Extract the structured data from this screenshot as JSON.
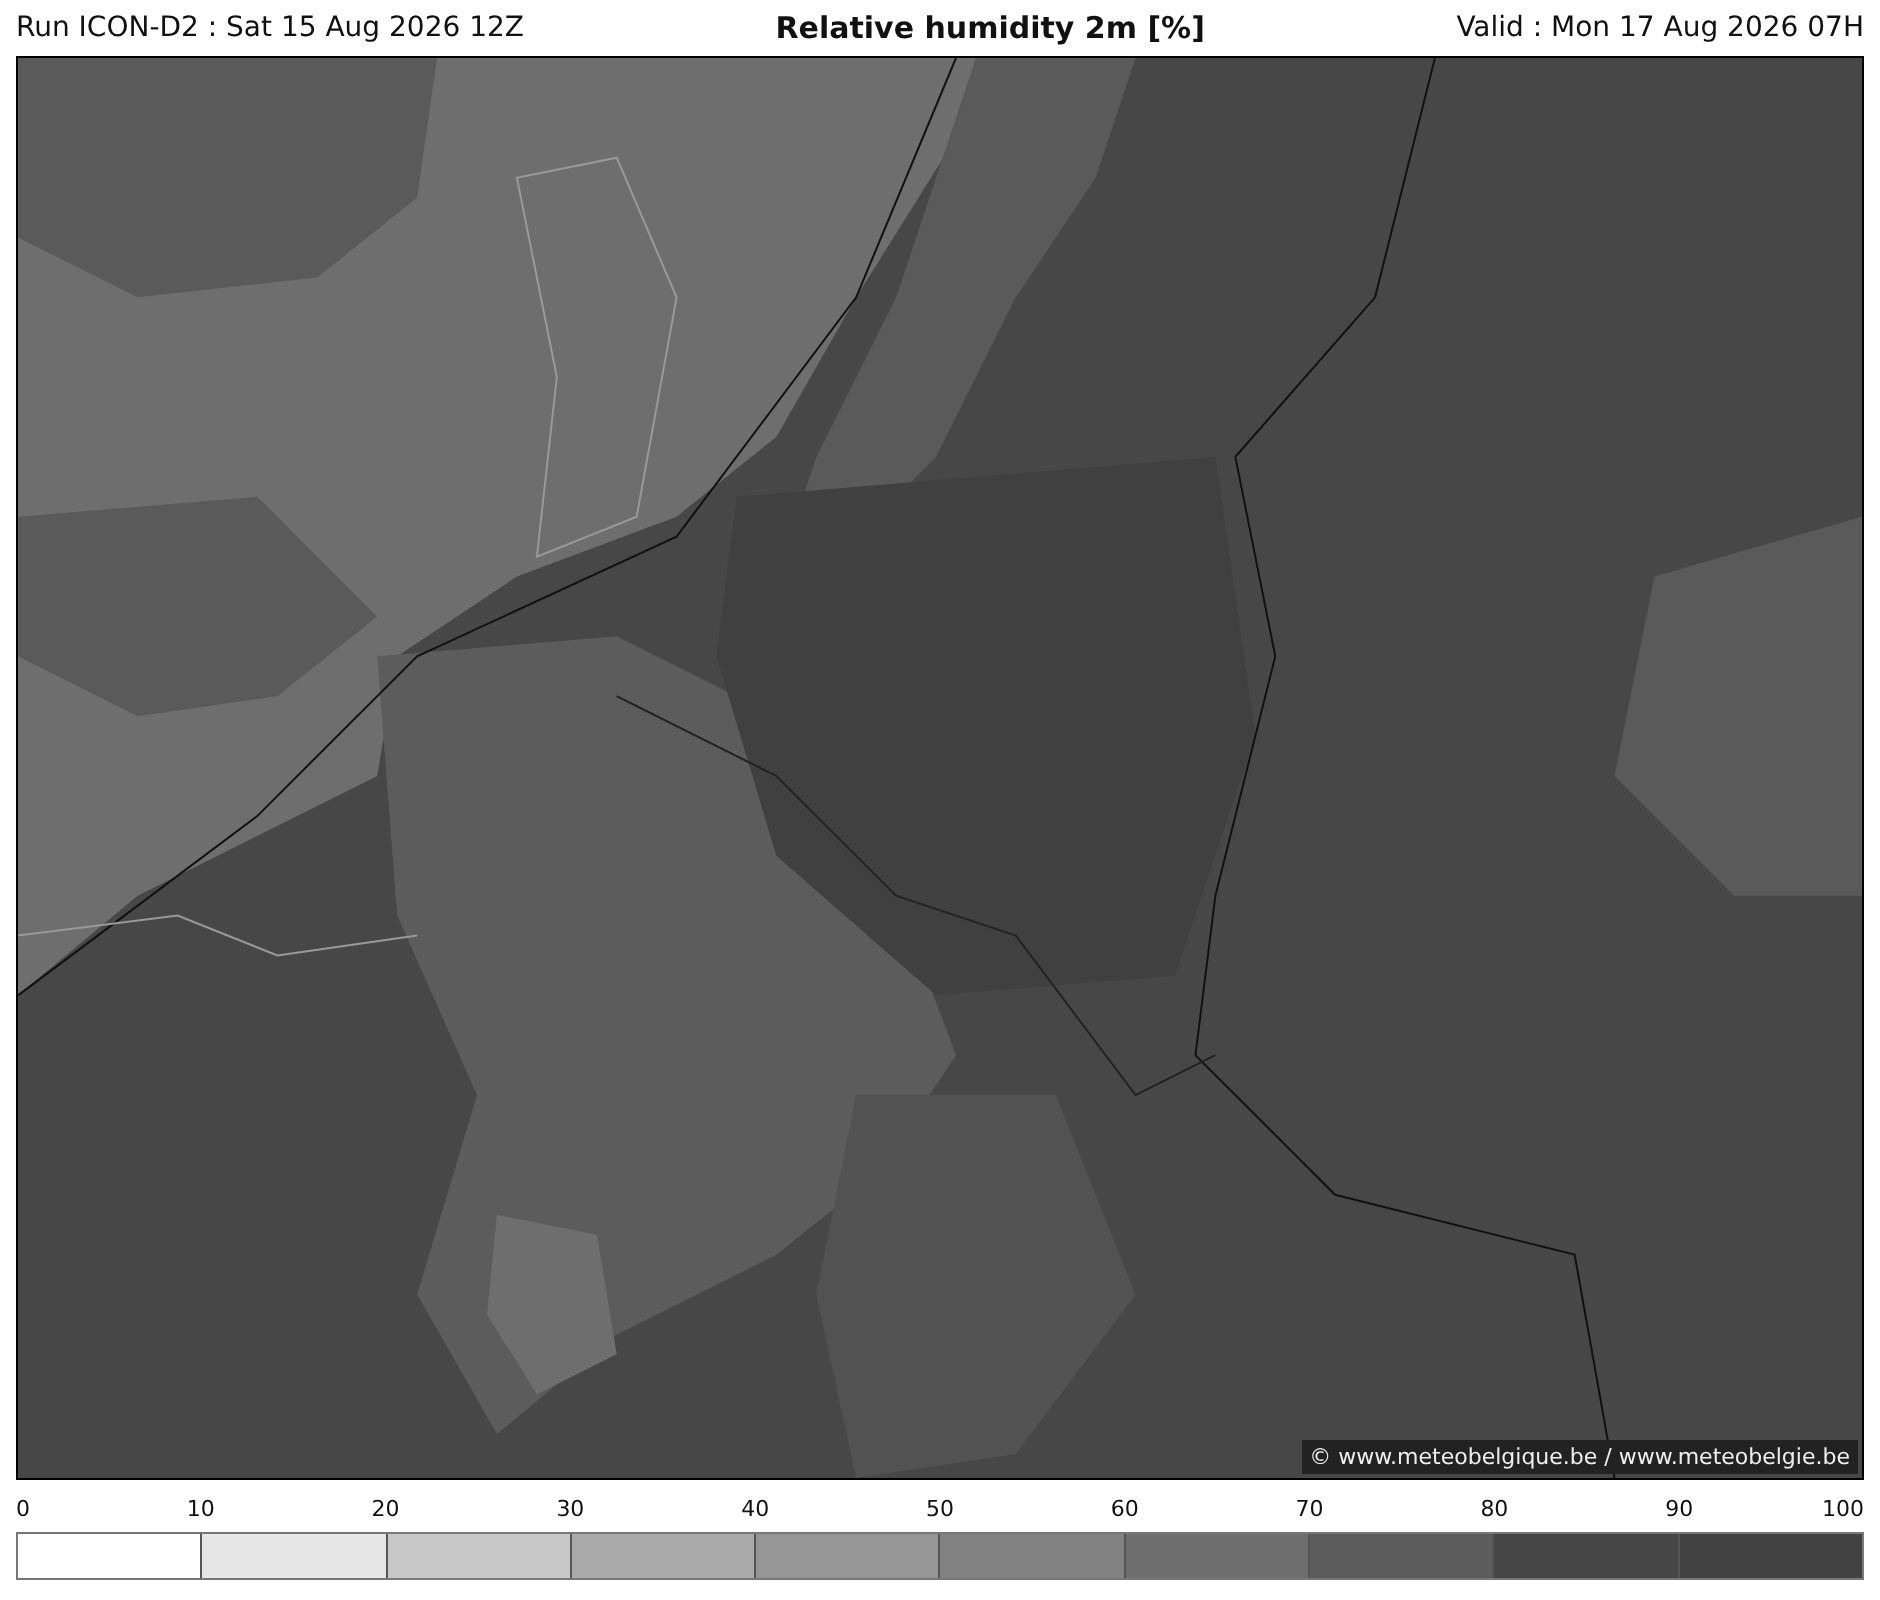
{
  "header": {
    "run": "Run ICON-D2 : Sat 15 Aug 2026 12Z",
    "title": "Relative humidity 2m [%]",
    "valid": "Valid : Mon 17 Aug 2026 07H"
  },
  "map": {
    "credit": "© www.meteobelgique.be / www.meteobelgie.be"
  },
  "legend": {
    "ticks": [
      "0",
      "10",
      "20",
      "30",
      "40",
      "50",
      "60",
      "70",
      "80",
      "90",
      "100"
    ],
    "bins": [
      {
        "color": "#ffffff"
      },
      {
        "color": "#e6e6e6"
      },
      {
        "color": "#c8c8c8"
      },
      {
        "color": "#aaaaaa"
      },
      {
        "color": "#969696"
      },
      {
        "color": "#828282"
      },
      {
        "color": "#6e6e6e"
      },
      {
        "color": "#5c5c5c"
      },
      {
        "color": "#464646"
      },
      {
        "color": "#424242"
      }
    ]
  }
}
